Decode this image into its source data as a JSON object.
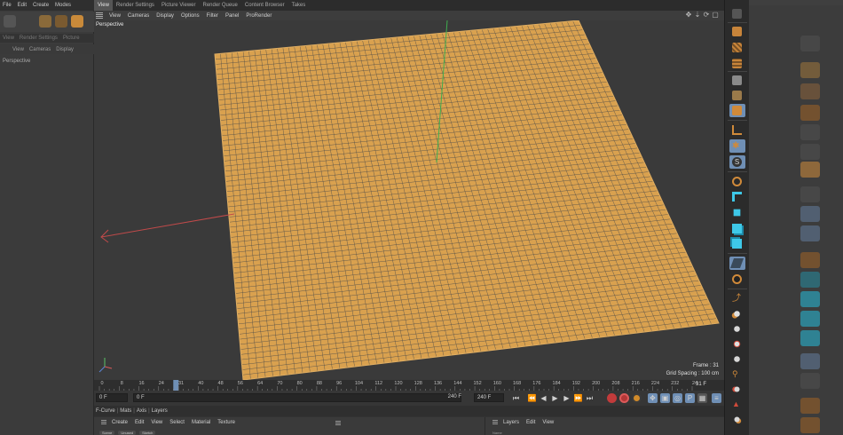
{
  "bg_window": {
    "menu": [
      "File",
      "Edit",
      "Create",
      "Modes"
    ],
    "tabs": [
      "View",
      "Render Settings",
      "Picture"
    ],
    "subtabs": [
      "View",
      "Cameras",
      "Display"
    ],
    "viewport_label": "Perspective"
  },
  "window_tabs": [
    {
      "label": "View",
      "active": true
    },
    {
      "label": "Render Settings",
      "active": false
    },
    {
      "label": "Picture Viewer",
      "active": false
    },
    {
      "label": "Render Queue",
      "active": false
    },
    {
      "label": "Content Browser",
      "active": false
    },
    {
      "label": "Takes",
      "active": false
    }
  ],
  "viewport_menu": [
    "View",
    "Cameras",
    "Display",
    "Options",
    "Filter",
    "Panel",
    "ProRender"
  ],
  "viewport": {
    "label": "Perspective",
    "frame_text": "Frame : 31",
    "grid_text": "Grid Spacing : 100 cm",
    "plane_color": "#d9a14f",
    "grid_line_color": "#4a4a4a"
  },
  "timeline": {
    "ticks": [
      0,
      8,
      16,
      24,
      32,
      40,
      48,
      56,
      64,
      72,
      80,
      88,
      96,
      104,
      112,
      120,
      128,
      136,
      144,
      152,
      160,
      168,
      176,
      184,
      192,
      200,
      208,
      216,
      224,
      232,
      240
    ],
    "visible_labels": [
      "0",
      "8",
      "16",
      "24",
      "31",
      "40",
      "48",
      "56",
      "64",
      "70",
      "80",
      "88",
      "96",
      "104",
      "112",
      "120",
      "128",
      "136",
      "144",
      "152",
      "160",
      "168",
      "176",
      "184",
      "192",
      "200",
      "208",
      "216",
      "224",
      "232",
      "24"
    ],
    "current_frame": 31,
    "current_text": "31 F",
    "max_frame": 240,
    "playhead_color": "#6f8fb5"
  },
  "transport": {
    "start_frame": "0 F",
    "min_field": "0 F",
    "max_field": "240 F",
    "end_frame": "240 F"
  },
  "bottom_tabs": [
    "F-Curve",
    "Mats",
    "Axis",
    "Layers"
  ],
  "material_menu": [
    "Create",
    "Edit",
    "View",
    "Select",
    "Material",
    "Texture"
  ],
  "material_filters": [
    "Scene",
    "Unused",
    "Sketch"
  ],
  "layers_menu": [
    "Layers",
    "Edit",
    "View"
  ],
  "layers_sub": "Name"
}
